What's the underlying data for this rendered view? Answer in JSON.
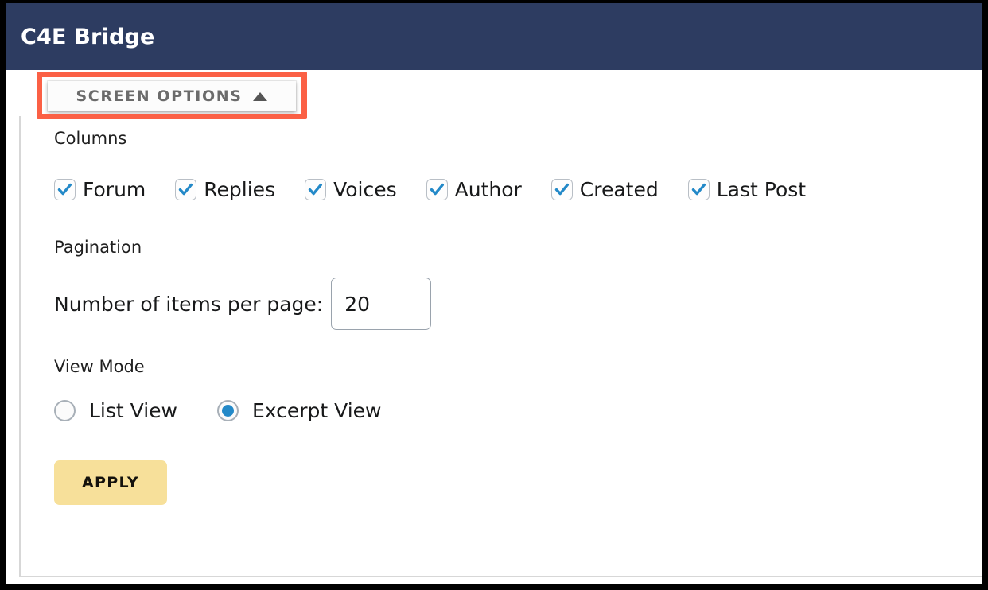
{
  "header": {
    "title": "C4E Bridge",
    "background_color": "#2d3c61"
  },
  "screen_options": {
    "label": "SCREEN OPTIONS",
    "caret_icon": "caret-up-icon",
    "highlight_color": "#fb6045"
  },
  "panel": {
    "columns": {
      "label": "Columns",
      "items": [
        {
          "label": "Forum",
          "checked": true
        },
        {
          "label": "Replies",
          "checked": true
        },
        {
          "label": "Voices",
          "checked": true
        },
        {
          "label": "Author",
          "checked": true
        },
        {
          "label": "Created",
          "checked": true
        },
        {
          "label": "Last Post",
          "checked": true
        }
      ],
      "check_color": "#2389c8"
    },
    "pagination": {
      "label": "Pagination",
      "items_per_page_label": "Number of items per page:",
      "items_per_page_value": "20",
      "items_per_page_placeholder": ""
    },
    "view_mode": {
      "label": "View Mode",
      "options": [
        {
          "label": "List View",
          "selected": false
        },
        {
          "label": "Excerpt View",
          "selected": true
        }
      ],
      "selected_color": "#2389c8"
    },
    "apply_button": {
      "label": "APPLY",
      "background_color": "#f7e09a"
    }
  }
}
